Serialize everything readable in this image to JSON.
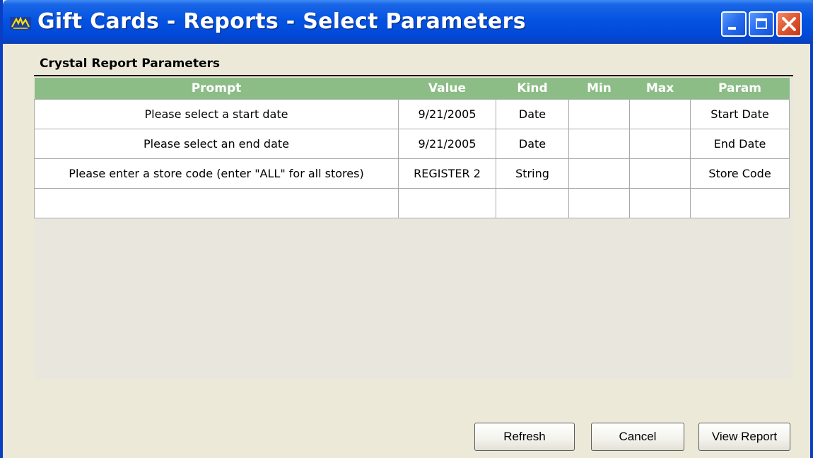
{
  "window": {
    "title": "Gift Cards - Reports - Select Parameters"
  },
  "section": {
    "title": "Crystal Report Parameters"
  },
  "grid": {
    "columns": [
      "Prompt",
      "Value",
      "Kind",
      "Min",
      "Max",
      "Param"
    ],
    "rows": [
      {
        "prompt": "Please select a start date",
        "value": "9/21/2005",
        "kind": "Date",
        "min": "",
        "max": "",
        "param": "Start Date"
      },
      {
        "prompt": "Please select an end date",
        "value": "9/21/2005",
        "kind": "Date",
        "min": "",
        "max": "",
        "param": "End Date"
      },
      {
        "prompt": "Please enter a store code (enter \"ALL\" for all stores)",
        "value": "REGISTER 2",
        "kind": "String",
        "min": "",
        "max": "",
        "param": "Store Code"
      },
      {
        "prompt": "",
        "value": "",
        "kind": "",
        "min": "",
        "max": "",
        "param": ""
      }
    ]
  },
  "buttons": {
    "refresh": "Refresh",
    "cancel": "Cancel",
    "view_report": "View Report"
  },
  "colors": {
    "titlebar": "#0553e2",
    "header": "#8cbd86",
    "close": "#e25a32"
  }
}
